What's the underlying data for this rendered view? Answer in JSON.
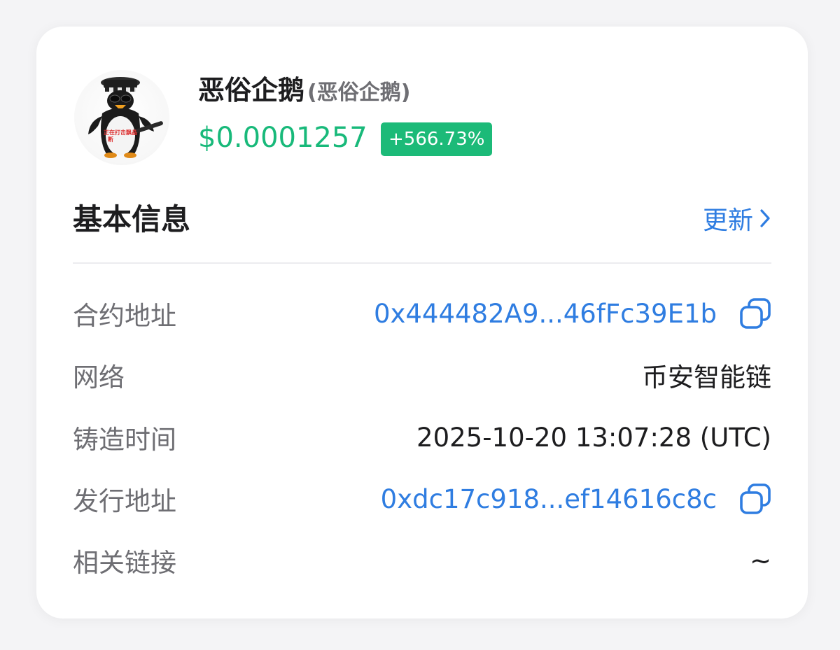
{
  "token": {
    "name": "恶俗企鹅",
    "symbol": "(恶俗企鹅)",
    "price": "$0.0001257",
    "change": "+566.73%",
    "logo_caption": "正在打击飘晶断"
  },
  "section": {
    "title": "基本信息",
    "update_label": "更新"
  },
  "rows": [
    {
      "label": "合约地址",
      "value": "0x444482A9...46fFc39E1b",
      "copyable": true
    },
    {
      "label": "网络",
      "value": "币安智能链",
      "copyable": false
    },
    {
      "label": "铸造时间",
      "value": "2025-10-20 13:07:28 (UTC)",
      "copyable": false
    },
    {
      "label": "发行地址",
      "value": "0xdc17c918...ef14616c8c",
      "copyable": true
    },
    {
      "label": "相关链接",
      "value": "~",
      "copyable": false
    }
  ],
  "icons": {
    "copy": "copy-icon",
    "chevron": "chevron-right-icon"
  },
  "colors": {
    "price_green": "#18b97a",
    "badge_green": "#1cba78",
    "link_blue": "#2f7de1",
    "label_gray": "#6e6e73",
    "text_dark": "#1d1d1f"
  }
}
